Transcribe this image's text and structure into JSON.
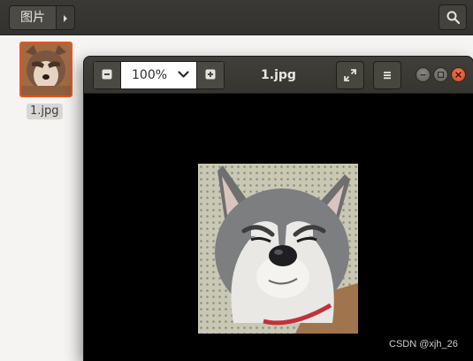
{
  "file_manager": {
    "breadcrumb": {
      "current_folder": "图片"
    },
    "icons": {
      "next": "chevron-right-icon",
      "search": "search-icon"
    },
    "files": [
      {
        "name": "1.jpg",
        "selected": true
      }
    ]
  },
  "viewer": {
    "title": "1.jpg",
    "zoom": {
      "value": "100%"
    },
    "icons": {
      "zoom_out": "minus-icon",
      "zoom_in": "plus-icon",
      "zoom_dropdown": "chevron-down-icon",
      "fullscreen": "fullscreen-icon",
      "menu": "hamburger-menu-icon",
      "minimize": "minimize-icon",
      "maximize": "maximize-icon",
      "close": "close-icon"
    },
    "image": {
      "subject": "husky",
      "file": "1.jpg"
    }
  },
  "watermark": "CSDN @xjh_26",
  "colors": {
    "accent": "#e95420",
    "header_dark": "#3a3935",
    "viewer_bg": "#000000",
    "window_close": "#e05a27"
  }
}
